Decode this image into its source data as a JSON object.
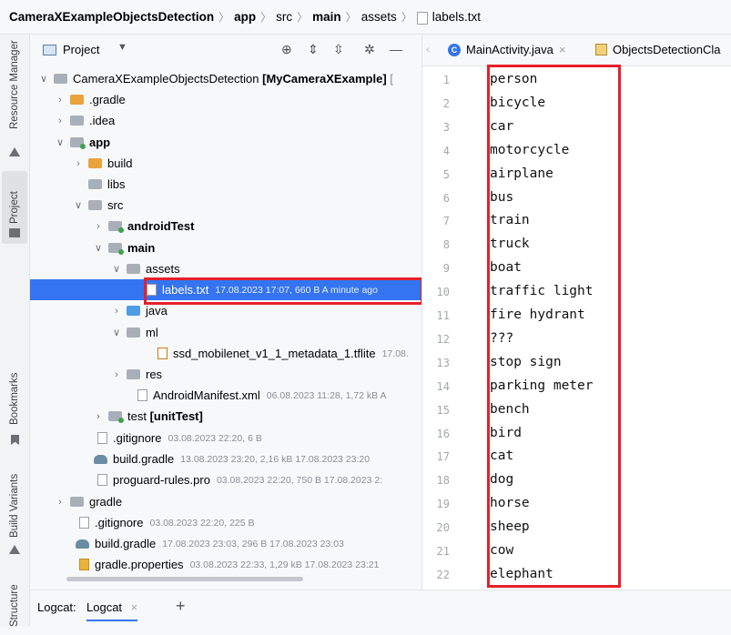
{
  "breadcrumb": {
    "items": [
      "CameraXExampleObjectsDetection",
      "app",
      "src",
      "main",
      "assets",
      "labels.txt"
    ]
  },
  "left_stripe": {
    "resource_manager": "Resource Manager",
    "project": "Project",
    "bookmarks": "Bookmarks",
    "build_variants": "Build Variants",
    "structure": "Structure"
  },
  "project_panel": {
    "title": "Project"
  },
  "tree": [
    {
      "label": "CameraXExampleObjectsDetection",
      "extra": "[MyCameraXExample]",
      "suffix": "[",
      "meta": ""
    },
    {
      "label": ".gradle",
      "meta": ""
    },
    {
      "label": ".idea",
      "meta": ""
    },
    {
      "label": "app",
      "meta": ""
    },
    {
      "label": "build",
      "meta": ""
    },
    {
      "label": "libs",
      "meta": ""
    },
    {
      "label": "src",
      "meta": ""
    },
    {
      "label": "androidTest",
      "meta": ""
    },
    {
      "label": "main",
      "meta": ""
    },
    {
      "label": "assets",
      "meta": ""
    },
    {
      "label": "labels.txt",
      "meta": "17.08.2023 17:07, 660 B A minute ago"
    },
    {
      "label": "java",
      "meta": ""
    },
    {
      "label": "ml",
      "meta": ""
    },
    {
      "label": "ssd_mobilenet_v1_1_metadata_1.tflite",
      "meta": "17.08."
    },
    {
      "label": "res",
      "meta": ""
    },
    {
      "label": "AndroidManifest.xml",
      "meta": "06.08.2023 11:28, 1,72 kB A"
    },
    {
      "label": "test",
      "extra": "[unitTest]",
      "meta": ""
    },
    {
      "label": ".gitignore",
      "meta": "03.08.2023 22:20, 6 B"
    },
    {
      "label": "build.gradle",
      "meta": "13.08.2023 23:20, 2,16 kB 17.08.2023 23:20"
    },
    {
      "label": "proguard-rules.pro",
      "meta": "03.08.2023 22:20, 750 B 17.08.2023 2:"
    },
    {
      "label": "gradle",
      "meta": ""
    },
    {
      "label": ".gitignore",
      "meta": "03.08.2023 22:20, 225 B"
    },
    {
      "label": "build.gradle",
      "meta": "17.08.2023 23:03, 296 B 17.08.2023 23:03"
    },
    {
      "label": "gradle.properties",
      "meta": "03.08.2023 22:33, 1,29 kB 17.08.2023 23:21"
    }
  ],
  "tabs": [
    {
      "label": "MainActivity.java",
      "close": "×"
    },
    {
      "label": "ObjectsDetectionCla",
      "close": ""
    }
  ],
  "editor": {
    "line_numbers": [
      "1",
      "2",
      "3",
      "4",
      "5",
      "6",
      "7",
      "8",
      "9",
      "10",
      "11",
      "12",
      "13",
      "14",
      "15",
      "16",
      "17",
      "18",
      "19",
      "20",
      "21",
      "22"
    ],
    "lines": [
      "person",
      "bicycle",
      "car",
      "motorcycle",
      "airplane",
      "bus",
      "train",
      "truck",
      "boat",
      "traffic light",
      "fire hydrant",
      "???",
      "stop sign",
      "parking meter",
      "bench",
      "bird",
      "cat",
      "dog",
      "horse",
      "sheep",
      "cow",
      "elephant"
    ]
  },
  "logcat": {
    "label": "Logcat:",
    "tab": "Logcat",
    "close": "×",
    "add": "+"
  },
  "colors": {
    "selection": "#3574f0",
    "highlight_box": "#e4202a"
  }
}
